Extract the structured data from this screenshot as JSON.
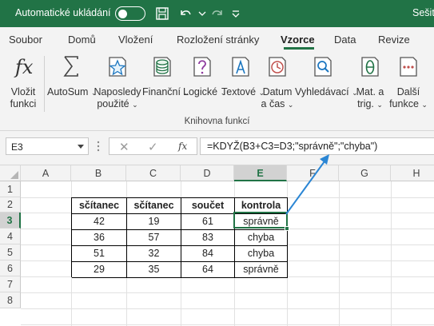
{
  "titlebar": {
    "autosave_label": "Automatické ukládání",
    "title_right": "Sešit"
  },
  "tabs": [
    "Soubor",
    "Domů",
    "Vložení",
    "Rozložení stránky",
    "Vzorce",
    "Data",
    "Revize"
  ],
  "active_tab": "Vzorce",
  "ribbon": {
    "buttons": [
      {
        "line1": "Vložit",
        "line2": "funkci",
        "icon": "fx-icon"
      },
      {
        "line1": "AutoSum",
        "line2": "",
        "icon": "sigma-icon",
        "dropdown": true
      },
      {
        "line1": "Naposledy",
        "line2": "použité",
        "icon": "star-icon",
        "dropdown": true
      },
      {
        "line1": "Finanční",
        "line2": "",
        "icon": "coins-icon",
        "dropdown": true
      },
      {
        "line1": "Logické",
        "line2": "",
        "icon": "question-icon",
        "dropdown": true
      },
      {
        "line1": "Textové",
        "line2": "",
        "icon": "text-icon",
        "dropdown": true
      },
      {
        "line1": "Datum",
        "line2": "a čas",
        "icon": "clock-icon",
        "dropdown": true
      },
      {
        "line1": "Vyhledávací",
        "line2": "",
        "icon": "lookup-icon",
        "dropdown": true
      },
      {
        "line1": "Mat. a",
        "line2": "trig.",
        "icon": "theta-icon",
        "dropdown": true
      },
      {
        "line1": "Další",
        "line2": "funkce",
        "icon": "more-icon",
        "dropdown": true
      }
    ],
    "group_label": "Knihovna funkcí"
  },
  "formula_bar": {
    "name_box": "E3",
    "fx_label": "fx",
    "formula": "=KDYŽ(B3+C3=D3;\"správně\";\"chyba\")"
  },
  "sheet": {
    "columns": [
      "A",
      "B",
      "C",
      "D",
      "E",
      "F",
      "G",
      "H"
    ],
    "rows": [
      "1",
      "2",
      "3",
      "4",
      "5",
      "6",
      "7",
      "8"
    ],
    "selected_cell": "E3",
    "table": {
      "headers": [
        "sčítanec",
        "sčítanec",
        "součet",
        "kontrola"
      ],
      "rows": [
        [
          "42",
          "19",
          "61",
          "správně"
        ],
        [
          "36",
          "57",
          "83",
          "chyba"
        ],
        [
          "51",
          "32",
          "84",
          "chyba"
        ],
        [
          "29",
          "35",
          "64",
          "správně"
        ]
      ]
    }
  },
  "colors": {
    "accent": "#217346",
    "annotation_arrow": "#2b86d4"
  }
}
